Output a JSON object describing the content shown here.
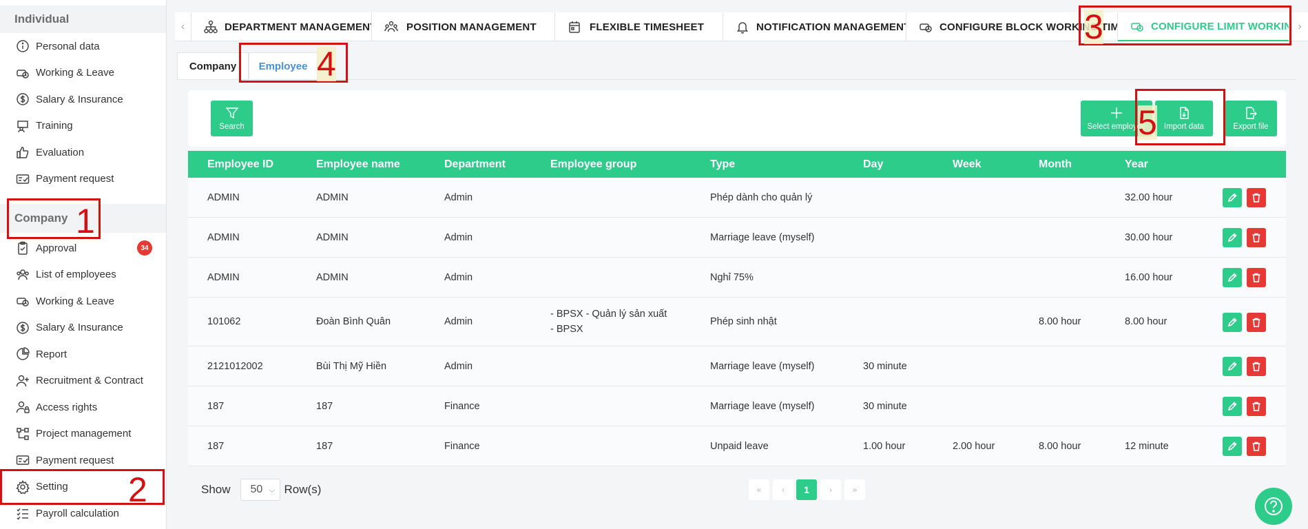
{
  "sidebar": {
    "individual_title": "Individual",
    "individual_items": [
      {
        "label": "Personal data",
        "icon": "info-icon"
      },
      {
        "label": "Working & Leave",
        "icon": "clock-car-icon"
      },
      {
        "label": "Salary & Insurance",
        "icon": "dollar-icon"
      },
      {
        "label": "Training",
        "icon": "training-icon"
      },
      {
        "label": "Evaluation",
        "icon": "evaluation-icon"
      },
      {
        "label": "Payment request",
        "icon": "payment-icon"
      }
    ],
    "company_title": "Company",
    "company_items": [
      {
        "label": "Approval",
        "icon": "clipboard-icon",
        "badge": "34"
      },
      {
        "label": "List of employees",
        "icon": "people-icon"
      },
      {
        "label": "Working & Leave",
        "icon": "clock-car-icon"
      },
      {
        "label": "Salary & Insurance",
        "icon": "dollar-icon"
      },
      {
        "label": "Report",
        "icon": "pie-chart-icon"
      },
      {
        "label": "Recruitment & Contract",
        "icon": "user-plus-icon"
      },
      {
        "label": "Access rights",
        "icon": "user-lock-icon"
      },
      {
        "label": "Project management",
        "icon": "project-icon"
      },
      {
        "label": "Payment request",
        "icon": "payment-icon"
      },
      {
        "label": "Setting",
        "icon": "gear-icon"
      },
      {
        "label": "Payroll calculation",
        "icon": "list-check-icon"
      }
    ]
  },
  "top_tabs": [
    {
      "label": "DEPARTMENT MANAGEMENT",
      "icon": "org-chart-icon"
    },
    {
      "label": "POSITION MANAGEMENT",
      "icon": "team-icon"
    },
    {
      "label": "FLEXIBLE TIMESHEET",
      "icon": "calendar-icon"
    },
    {
      "label": "NOTIFICATION MANAGEMENT",
      "icon": "bell-icon"
    },
    {
      "label": "CONFIGURE BLOCK WORKING TIME",
      "icon": "clock-car-icon"
    },
    {
      "label": "CONFIGURE LIMIT WORKING TIME",
      "icon": "clock-car-icon",
      "active": true
    }
  ],
  "sub_tabs": [
    {
      "label": "Company"
    },
    {
      "label": "Employee",
      "active": true
    }
  ],
  "toolbar": {
    "search_label": "Search",
    "select_label": "Select employee",
    "import_label": "Import data",
    "export_label": "Export file"
  },
  "table": {
    "columns": [
      "Employee ID",
      "Employee name",
      "Department",
      "Employee group",
      "Type",
      "Day",
      "Week",
      "Month",
      "Year"
    ],
    "rows": [
      {
        "id": "ADMIN",
        "name": "ADMIN",
        "dept": "Admin",
        "group1": "",
        "group2": "",
        "type": "Phép dành cho quản lý",
        "day": "",
        "week": "",
        "month": "",
        "year": "32.00 hour"
      },
      {
        "id": "ADMIN",
        "name": "ADMIN",
        "dept": "Admin",
        "group1": "",
        "group2": "",
        "type": "Marriage leave (myself)",
        "day": "",
        "week": "",
        "month": "",
        "year": "30.00 hour"
      },
      {
        "id": "ADMIN",
        "name": "ADMIN",
        "dept": "Admin",
        "group1": "",
        "group2": "",
        "type": "Nghỉ 75%",
        "day": "",
        "week": "",
        "month": "",
        "year": "16.00 hour"
      },
      {
        "id": "101062",
        "name": "Đoàn Bình Quân",
        "dept": "Admin",
        "group1": "- BPSX - Quản lý sản xuất",
        "group2": "- BPSX",
        "type": "Phép sinh nhật",
        "day": "",
        "week": "",
        "month": "8.00 hour",
        "year": "8.00 hour"
      },
      {
        "id": "2121012002",
        "name": "Bùi Thị Mỹ Hiền",
        "dept": "Admin",
        "group1": "",
        "group2": "",
        "type": "Marriage leave (myself)",
        "day": "30 minute",
        "week": "",
        "month": "",
        "year": ""
      },
      {
        "id": "187",
        "name": "187",
        "dept": "Finance",
        "group1": "",
        "group2": "",
        "type": "Marriage leave (myself)",
        "day": "30 minute",
        "week": "",
        "month": "",
        "year": ""
      },
      {
        "id": "187",
        "name": "187",
        "dept": "Finance",
        "group1": "",
        "group2": "",
        "type": "Unpaid leave",
        "day": "1.00 hour",
        "week": "2.00 hour",
        "month": "8.00 hour",
        "year": "12 minute"
      }
    ]
  },
  "pagination": {
    "show_label": "Show",
    "rows_value": "50",
    "rows_label": "Row(s)",
    "first": "«",
    "prev": "‹",
    "current_page": "1",
    "next": "›",
    "last": "»"
  },
  "annotations": [
    "1",
    "2",
    "3",
    "4",
    "5"
  ],
  "colors": {
    "accent": "#2ecc8a",
    "danger": "#e53935",
    "annotation": "#d41010"
  }
}
